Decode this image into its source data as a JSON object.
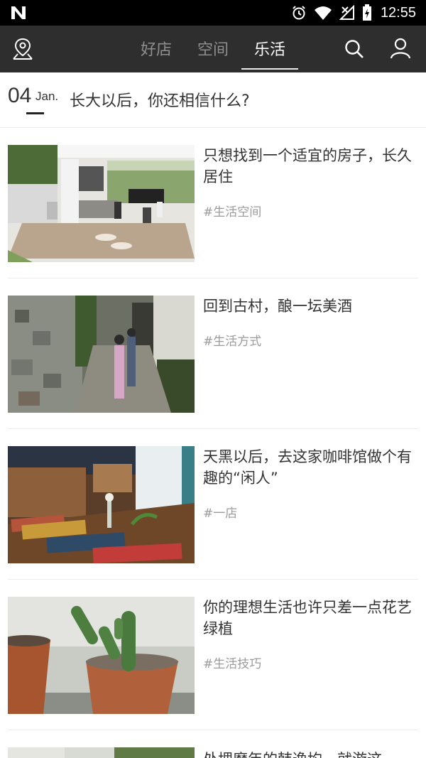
{
  "status": {
    "time": "12:55"
  },
  "nav": {
    "tabs": [
      {
        "label": "好店"
      },
      {
        "label": "空间"
      },
      {
        "label": "乐活"
      }
    ]
  },
  "header": {
    "day": "04",
    "month": "Jan.",
    "title": "长大以后，你还相信什么?"
  },
  "articles": [
    {
      "title": "只想找到一个适宜的房子，长久居住",
      "tag": "#生活空间"
    },
    {
      "title": "回到古村，酿一坛美酒",
      "tag": "#生活方式"
    },
    {
      "title": "天黑以后，去这家咖啡馆做个有趣的“闲人”",
      "tag": "#一店"
    },
    {
      "title": "你的理想生活也许只差一点花艺绿植",
      "tag": "#生活技巧"
    },
    {
      "title": "处埋磨年的韩逸均，就游这"
    }
  ]
}
